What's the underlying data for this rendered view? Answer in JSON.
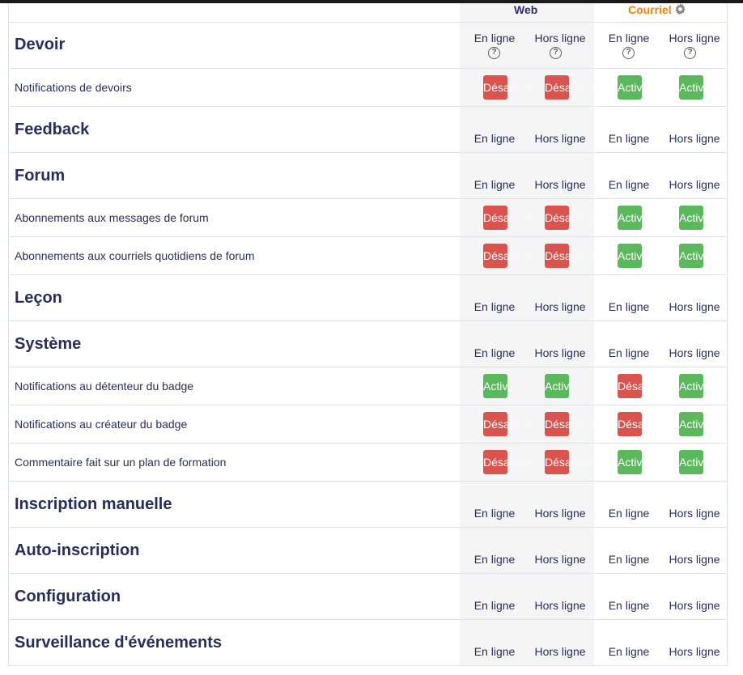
{
  "processors": {
    "web": "Web",
    "email": "Courriel"
  },
  "state_labels": {
    "online": "En ligne",
    "offline": "Hors ligne"
  },
  "toggle_labels": {
    "off": "Désactivé",
    "on": "Activé"
  },
  "colors": {
    "off": "#d9534f",
    "on": "#5cb85c",
    "section_text": "#282e5c",
    "email_accent": "#f98012"
  },
  "sections": [
    {
      "title": "Devoir",
      "items": [
        {
          "label": "Notifications de devoirs",
          "states": [
            "off",
            "off",
            "on",
            "on"
          ]
        }
      ]
    },
    {
      "title": "Feedback",
      "items": []
    },
    {
      "title": "Forum",
      "items": [
        {
          "label": "Abonnements aux messages de forum",
          "states": [
            "off",
            "off",
            "on",
            "on"
          ]
        },
        {
          "label": "Abonnements aux courriels quotidiens de forum",
          "states": [
            "off",
            "off",
            "on",
            "on"
          ]
        }
      ]
    },
    {
      "title": "Leçon",
      "items": []
    },
    {
      "title": "Système",
      "items": [
        {
          "label": "Notifications au détenteur du badge",
          "states": [
            "on",
            "on",
            "off",
            "on"
          ]
        },
        {
          "label": "Notifications au créateur du badge",
          "states": [
            "off",
            "off",
            "off",
            "on"
          ]
        },
        {
          "label": "Commentaire fait sur un plan de formation",
          "states": [
            "off",
            "off",
            "on",
            "on"
          ]
        }
      ]
    },
    {
      "title": "Inscription manuelle",
      "items": []
    },
    {
      "title": "Auto-inscription",
      "items": []
    },
    {
      "title": "Configuration",
      "items": []
    },
    {
      "title": "Surveillance d'événements",
      "items": []
    }
  ]
}
